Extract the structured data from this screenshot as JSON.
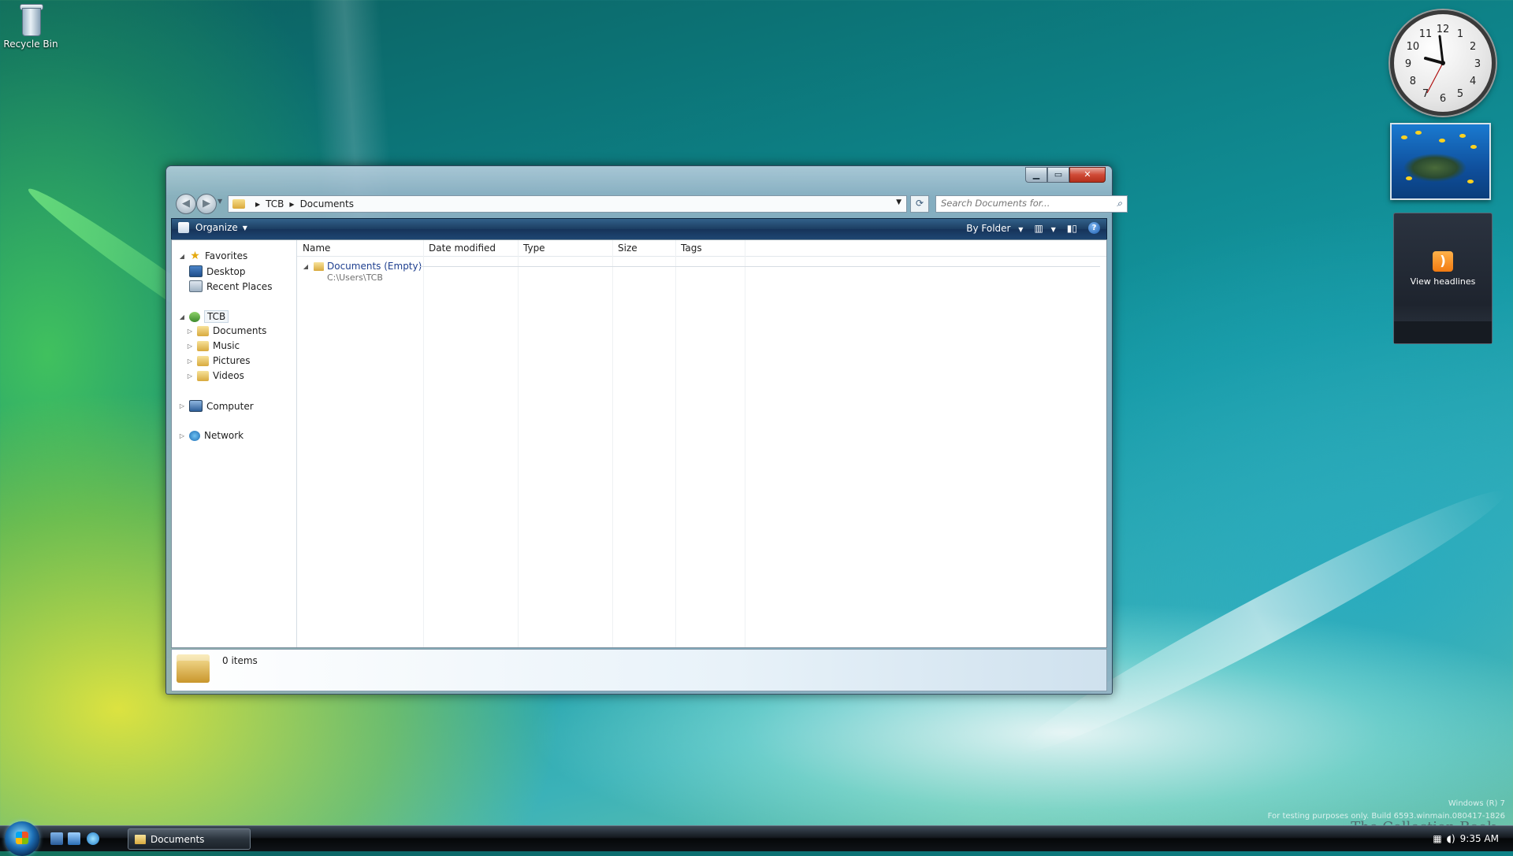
{
  "desktop": {
    "recycle_bin_label": "Recycle Bin",
    "watermark_line1": "Windows (R) 7",
    "watermark_line2": "For testing purposes only. Build 6593.winmain.080417-1826",
    "book_watermark": "The Collection Book"
  },
  "gadgets": {
    "clock_numbers": [
      "12",
      "1",
      "2",
      "3",
      "4",
      "5",
      "6",
      "7",
      "8",
      "9",
      "10",
      "11"
    ],
    "feed_label": "View headlines"
  },
  "window": {
    "address": {
      "crumbs": [
        "TCB",
        "Documents"
      ]
    },
    "search": {
      "placeholder": "Search Documents for..."
    },
    "command_bar": {
      "organize": "Organize",
      "by_folder": "By Folder"
    },
    "nav_pane": {
      "favorites": "Favorites",
      "desktop": "Desktop",
      "recent_places": "Recent Places",
      "user": "TCB",
      "documents": "Documents",
      "music": "Music",
      "pictures": "Pictures",
      "videos": "Videos",
      "computer": "Computer",
      "network": "Network"
    },
    "columns": [
      "Name",
      "Date modified",
      "Type",
      "Size",
      "Tags"
    ],
    "group": {
      "label": "Documents (Empty)",
      "path": "C:\\Users\\TCB"
    },
    "details": {
      "count": "0 items"
    }
  },
  "taskbar": {
    "task_label": "Documents",
    "time": "9:35 AM"
  },
  "colors": {
    "command_bar": "#1c3d61",
    "link_blue": "#1e3f8f",
    "close_red": "#cf4a36"
  }
}
